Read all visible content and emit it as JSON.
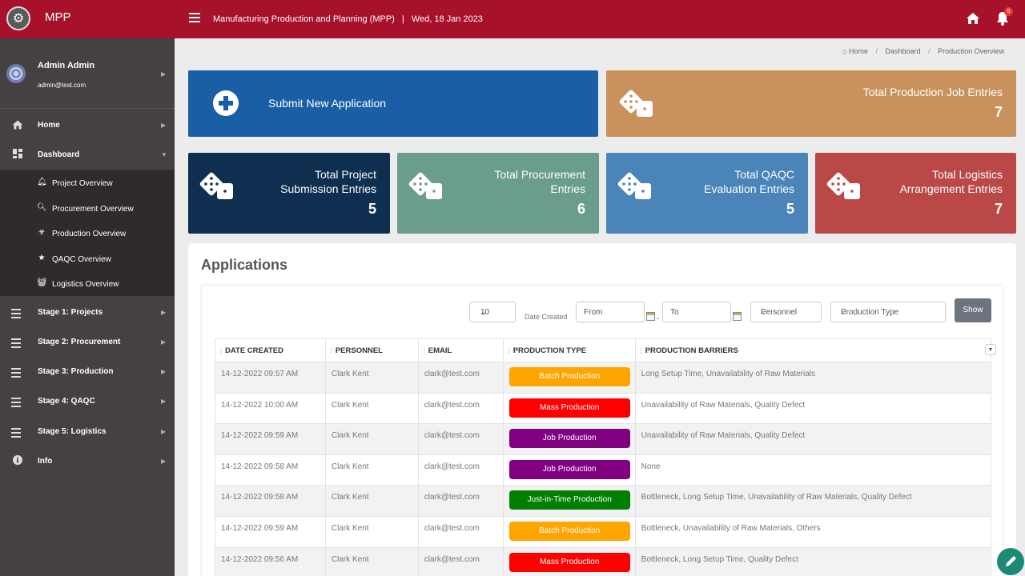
{
  "app": {
    "name": "MPP",
    "title": "Manufacturing Production and Planning (MPP)",
    "separator": "|",
    "date": "Wed, 18 Jan 2023",
    "notification_count": "0"
  },
  "user": {
    "name": "Admin Admin",
    "email": "admin@test.com"
  },
  "sidebar": {
    "items": [
      {
        "label": "Home",
        "icon": "home-icon"
      },
      {
        "label": "Dashboard",
        "icon": "dashboard-icon"
      },
      {
        "label": "Stage 1: Projects",
        "icon": "list-icon"
      },
      {
        "label": "Stage 2: Procurement",
        "icon": "list-icon"
      },
      {
        "label": "Stage 3: Production",
        "icon": "list-icon"
      },
      {
        "label": "Stage 4: QAQC",
        "icon": "list-icon"
      },
      {
        "label": "Stage 5: Logistics",
        "icon": "list-icon"
      },
      {
        "label": "Info",
        "icon": "info-icon"
      }
    ],
    "subitems": [
      {
        "label": "Project Overview",
        "icon": "bell-icon"
      },
      {
        "label": "Procurement Overview",
        "icon": "search-icon"
      },
      {
        "label": "Production Overview",
        "icon": "biohazard-icon"
      },
      {
        "label": "QAQC Overview",
        "icon": "star-icon"
      },
      {
        "label": "Logistics Overview",
        "icon": "basket-icon"
      }
    ]
  },
  "breadcrumb": {
    "home": "Home",
    "dashboard": "Dashboard",
    "current": "Production Overview",
    "sep": "/"
  },
  "cards": {
    "submit": {
      "label": "Submit New Application"
    },
    "production": {
      "title": "Total Production Job Entries",
      "value": "7",
      "color": "#c9915c"
    },
    "project": {
      "line1": "Total Project",
      "line2": "Submission Entries",
      "value": "5",
      "color": "#0e2f4f"
    },
    "procurement": {
      "line1": "Total Procurement",
      "line2": "Entries",
      "value": "6",
      "color": "#6b9d8d"
    },
    "qaqc": {
      "line1": "Total QAQC",
      "line2": "Evaluation Entries",
      "value": "5",
      "color": "#4a84b9"
    },
    "logistics": {
      "line1": "Total Logistics",
      "line2": "Arrangement Entries",
      "value": "7",
      "color": "#b94847"
    }
  },
  "applications": {
    "title": "Applications",
    "filters": {
      "page_size": "10",
      "date_label": "Date Created",
      "from_placeholder": "From",
      "to_placeholder": "To",
      "personnel": "Personnel",
      "production_type": "Production Type",
      "show_label": "Show"
    },
    "columns": [
      "DATE CREATED",
      "PERSONNEL",
      "EMAIL",
      "PRODUCTION TYPE",
      "PRODUCTION BARRIERS"
    ],
    "rows": [
      {
        "date": "14-12-2022 09:57 AM",
        "personnel": "Clark Kent",
        "email": "clark@test.com",
        "type": "Batch Production",
        "type_color": "#ffa500",
        "barriers": "Long Setup Time, Unavailability of Raw Materials"
      },
      {
        "date": "14-12-2022 10:00 AM",
        "personnel": "Clark Kent",
        "email": "clark@test.com",
        "type": "Mass Production",
        "type_color": "#ff0000",
        "barriers": "Unavailability of Raw Materials, Quality Defect"
      },
      {
        "date": "14-12-2022 09:59 AM",
        "personnel": "Clark Kent",
        "email": "clark@test.com",
        "type": "Job Production",
        "type_color": "#800080",
        "barriers": "Unavailability of Raw Materials, Quality Defect"
      },
      {
        "date": "14-12-2022 09:58 AM",
        "personnel": "Clark Kent",
        "email": "clark@test.com",
        "type": "Job Production",
        "type_color": "#800080",
        "barriers": "None"
      },
      {
        "date": "14-12-2022 09:58 AM",
        "personnel": "Clark Kent",
        "email": "clark@test.com",
        "type": "Just-in-Time Production",
        "type_color": "#008000",
        "barriers": "Bottleneck, Long Setup Time, Unavailability of Raw Materials, Quality Defect"
      },
      {
        "date": "14-12-2022 09:59 AM",
        "personnel": "Clark Kent",
        "email": "clark@test.com",
        "type": "Batch Production",
        "type_color": "#ffa500",
        "barriers": "Bottleneck, Unavailability of Raw Materials, Others"
      },
      {
        "date": "14-12-2022 09:56 AM",
        "personnel": "Clark Kent",
        "email": "clark@test.com",
        "type": "Mass Production",
        "type_color": "#ff0000",
        "barriers": "Bottleneck, Long Setup Time, Quality Defect"
      }
    ]
  },
  "colors": {
    "topbar": "#a7122a",
    "sidebar": "#454142",
    "submenu": "#2f2b2c",
    "submit_card": "#1a5fa6",
    "fab": "#1c8a74"
  }
}
